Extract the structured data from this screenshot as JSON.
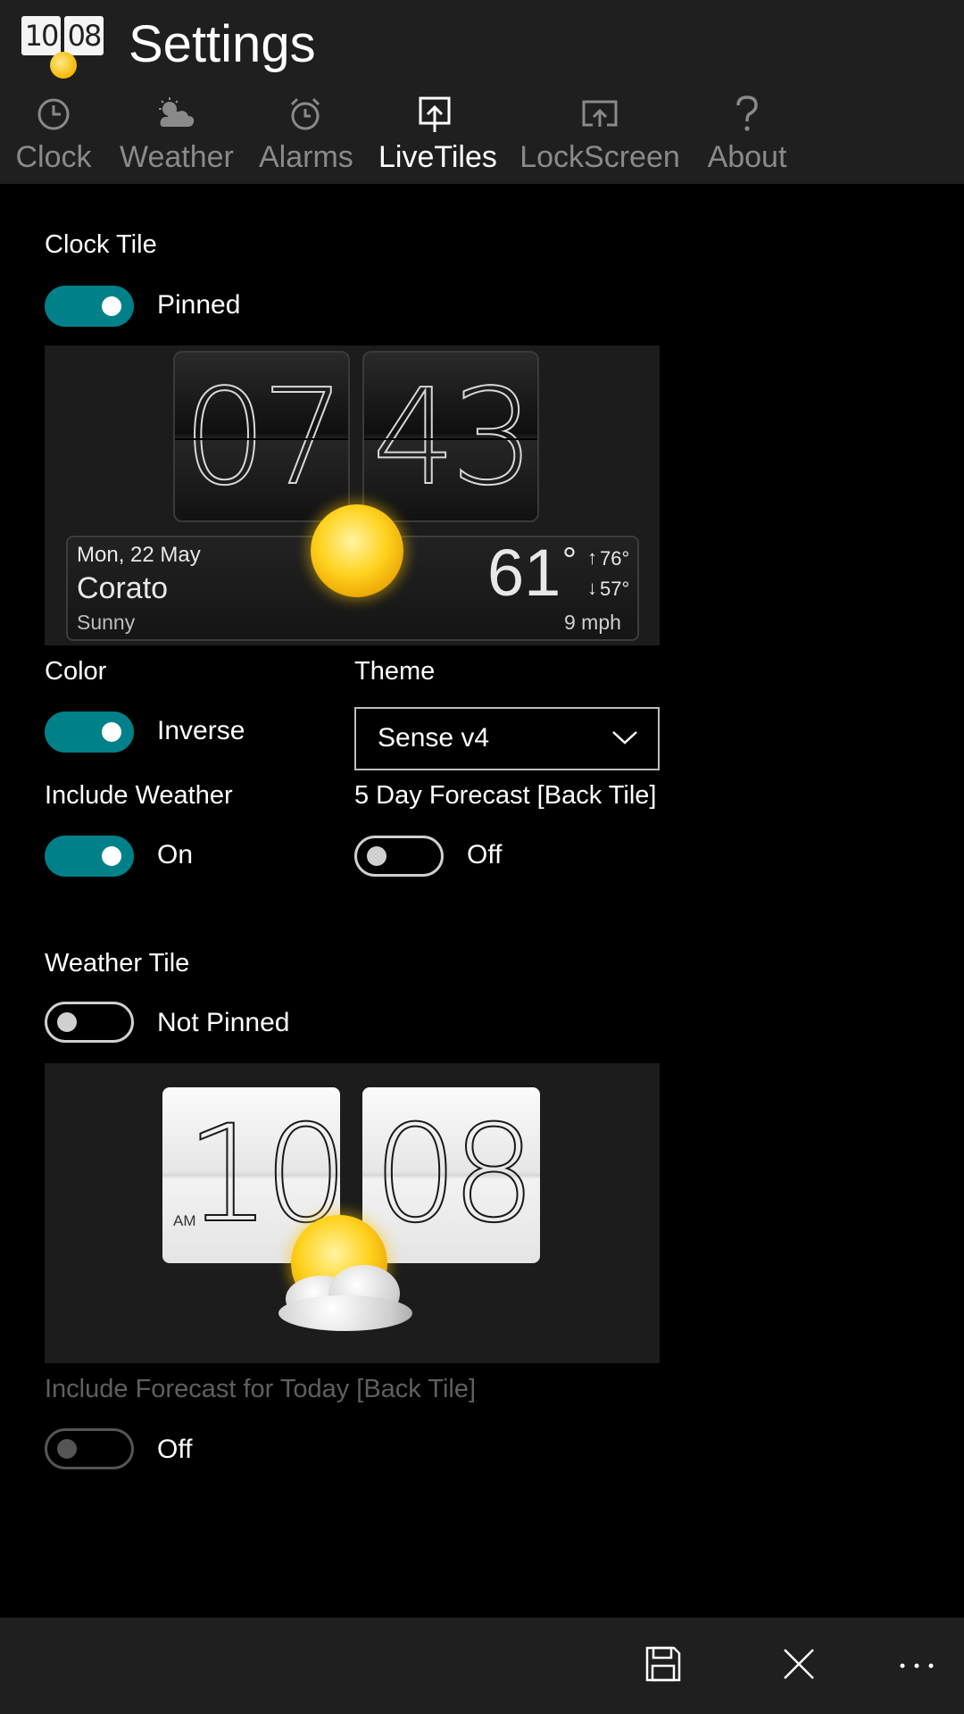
{
  "header": {
    "title": "Settings",
    "app_icon": {
      "hours": "10",
      "minutes": "08",
      "icon": "weather-sun-icon"
    }
  },
  "tabs": [
    {
      "label": "Clock",
      "icon": "clock-icon",
      "active": false
    },
    {
      "label": "Weather",
      "icon": "partly-cloudy-icon",
      "active": false
    },
    {
      "label": "Alarms",
      "icon": "alarm-icon",
      "active": false
    },
    {
      "label": "LiveTiles",
      "icon": "pin-tile-icon",
      "active": true
    },
    {
      "label": "LockScreen",
      "icon": "lockscreen-icon",
      "active": false
    },
    {
      "label": "About",
      "icon": "question-icon",
      "active": false
    }
  ],
  "clock_tile": {
    "heading": "Clock Tile",
    "toggle_state": "Pinned",
    "toggle_on": true,
    "preview": {
      "hours": "07",
      "minutes": "43",
      "date": "Mon, 22 May",
      "city": "Corato",
      "condition": "Sunny",
      "temp": "61",
      "deg": "°",
      "high": "76°",
      "low": "57°",
      "wind": "9 mph"
    }
  },
  "color": {
    "label": "Color",
    "toggle_state": "Inverse",
    "toggle_on": true
  },
  "theme": {
    "label": "Theme",
    "value": "Sense v4"
  },
  "include_weather": {
    "label": "Include Weather",
    "toggle_state": "On",
    "toggle_on": true
  },
  "forecast_back": {
    "label": "5 Day Forecast [Back Tile]",
    "toggle_state": "Off",
    "toggle_on": false
  },
  "weather_tile": {
    "heading": "Weather Tile",
    "toggle_state": "Not Pinned",
    "toggle_on": false,
    "preview": {
      "hours": "10",
      "minutes": "08",
      "ampm": "AM",
      "icon": "partly-cloudy-icon"
    }
  },
  "forecast_today": {
    "label": "Include Forecast for Today [Back Tile]",
    "toggle_state": "Off",
    "toggle_on": false,
    "enabled": false
  },
  "appbar": {
    "buttons": [
      {
        "icon": "save-icon"
      },
      {
        "icon": "close-icon"
      },
      {
        "icon": "more-icon"
      }
    ]
  },
  "colors": {
    "accent": "#00818a",
    "chrome": "#1f1f1f",
    "background": "#000000"
  }
}
